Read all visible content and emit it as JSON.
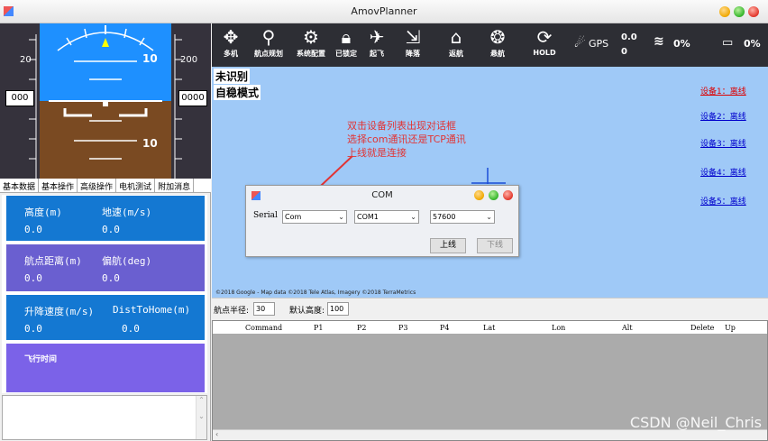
{
  "window": {
    "title": "AmovPlanner"
  },
  "hud": {
    "left_scale_top": "20",
    "right_scale_top": "200",
    "pitch_top": "10",
    "pitch_bottom": "10",
    "alt_box": "000",
    "spd_box": "0000"
  },
  "tabs": [
    "基本数据",
    "基本操作",
    "高级操作",
    "电机测试",
    "附加消息"
  ],
  "tiles": {
    "altitude_label": "高度(m)",
    "altitude_value": "0.0",
    "groundspeed_label": "地速(m/s)",
    "groundspeed_value": "0.0",
    "wp_dist_label": "航点距离(m)",
    "wp_dist_value": "0.0",
    "yaw_label": "偏航(deg)",
    "yaw_value": "0.0",
    "climb_label": "升降速度(m/s)",
    "climb_value": "0.0",
    "dist_home_label": "DistToHome(m)",
    "dist_home_value": "0.0",
    "flight_time_label": "飞行时间"
  },
  "toolbar": {
    "buttons": [
      "多机",
      "航点规划",
      "系统配置",
      "已锁定",
      "起飞",
      "降落",
      "返航",
      "悬航",
      "HOLD"
    ],
    "gps_label": "GPS",
    "gps_top": "0.0",
    "gps_bottom": "0",
    "wifi_value": "0%",
    "battery_value": "0%"
  },
  "map": {
    "status_line1": "未识别",
    "status_line2": "自稳模式",
    "devices": [
      "设备1：离线",
      "设备2：离线",
      "设备3：离线",
      "设备4：离线",
      "设备5：离线"
    ],
    "note": [
      "双击设备列表出现对话框",
      "选择com通讯还是TCP通讯",
      "上线就是连接"
    ],
    "copyright": "©2018 Google - Map data ©2018 Tele Atlas, Imagery ©2018 TerraMetrics"
  },
  "dialog": {
    "title": "COM",
    "serial_label": "Serial",
    "type_value": "Com",
    "port_value": "COM1",
    "baud_value": "57600",
    "online_button": "上线",
    "offline_button": "下线"
  },
  "wpbar": {
    "radius_label": "航点半径:",
    "radius_value": "30",
    "default_alt_label": "默认高度:",
    "default_alt_value": "100"
  },
  "grid": {
    "columns": [
      "Command",
      "P1",
      "P2",
      "P3",
      "P4",
      "Lat",
      "Lon",
      "Alt",
      "Delete",
      "Up"
    ]
  },
  "watermark": "CSDN @Neil_Chris",
  "colors": {
    "tile_blue": "#1478d2",
    "tile_purple": "#6a5fd0",
    "tile_violet": "#7b62e8",
    "map_bg": "#9fc9f7",
    "toolbar_bg": "#2d2e34"
  }
}
